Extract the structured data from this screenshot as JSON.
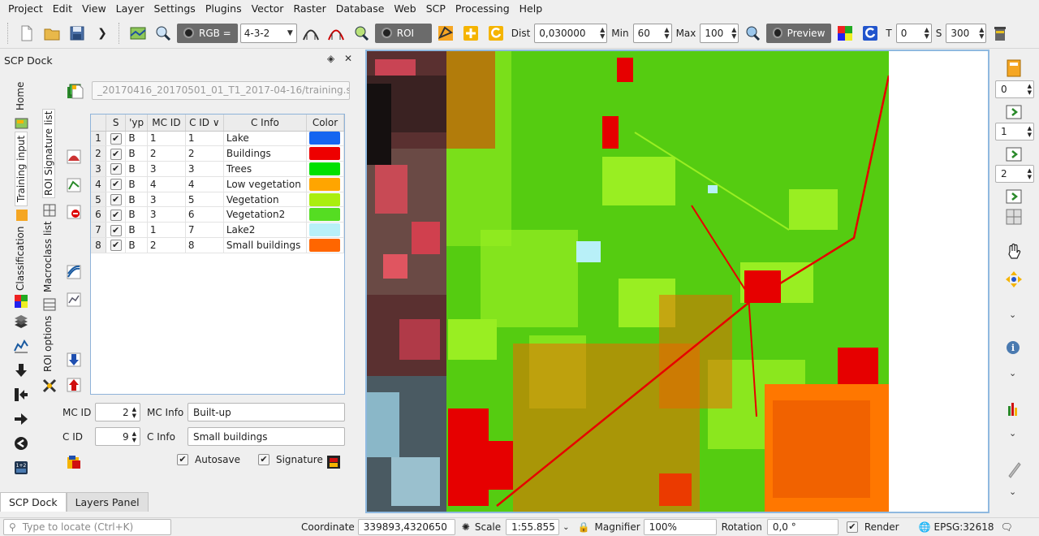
{
  "menubar": [
    "Project",
    "Edit",
    "View",
    "Layer",
    "Settings",
    "Plugins",
    "Vector",
    "Raster",
    "Database",
    "Web",
    "SCP",
    "Processing",
    "Help"
  ],
  "toolbar": {
    "rgb_label": "RGB =",
    "rgb_value": "4-3-2",
    "roi_label": "ROI",
    "dist_label": "Dist",
    "dist_value": "0,030000",
    "min_label": "Min",
    "min_value": "60",
    "max_label": "Max",
    "max_value": "100",
    "preview_label": "Preview",
    "t_label": "T",
    "t_value": "0",
    "s_label": "S",
    "s_value": "300"
  },
  "dock": {
    "title": "SCP Dock",
    "tabs_outer": [
      "Home",
      "Training input",
      "Classification"
    ],
    "tabs_inner": [
      "ROI Signature list",
      "Macroclass list",
      "ROI options"
    ],
    "training_file": "_20170416_20170501_01_T1_2017-04-16/training.scp",
    "table": {
      "headers": [
        "S",
        "Type",
        "MC ID",
        "C ID",
        "C Info",
        "Color"
      ],
      "header_display": [
        "S",
        "'yp",
        "MC ID",
        "C ID ∨",
        "C Info",
        "Color"
      ],
      "rows": [
        {
          "n": "1",
          "type": "B",
          "mc": "1",
          "c": "1",
          "info": "Lake",
          "color": "#1565f0"
        },
        {
          "n": "2",
          "type": "B",
          "mc": "2",
          "c": "2",
          "info": "Buildings",
          "color": "#ee0000"
        },
        {
          "n": "3",
          "type": "B",
          "mc": "3",
          "c": "3",
          "info": "Trees",
          "color": "#00e000"
        },
        {
          "n": "4",
          "type": "B",
          "mc": "4",
          "c": "4",
          "info": "Low vegetation",
          "color": "#ffa500"
        },
        {
          "n": "5",
          "type": "B",
          "mc": "3",
          "c": "5",
          "info": "Vegetation",
          "color": "#aaee10"
        },
        {
          "n": "6",
          "type": "B",
          "mc": "3",
          "c": "6",
          "info": "Vegetation2",
          "color": "#55dd22"
        },
        {
          "n": "7",
          "type": "B",
          "mc": "1",
          "c": "7",
          "info": "Lake2",
          "color": "#b8f0f8"
        },
        {
          "n": "8",
          "type": "B",
          "mc": "2",
          "c": "8",
          "info": "Small buildings",
          "color": "#ff6600"
        }
      ]
    },
    "form": {
      "mc_id_label": "MC ID",
      "mc_id_value": "2",
      "mc_info_label": "MC Info",
      "mc_info_value": "Built-up",
      "c_id_label": "C ID",
      "c_id_value": "9",
      "c_info_label": "C Info",
      "c_info_value": "Small buildings",
      "autosave_label": "Autosave",
      "signature_label": "Signature"
    },
    "bottom_tabs": [
      "SCP Dock",
      "Layers Panel"
    ]
  },
  "right_bar": {
    "spin1": "0",
    "spin2": "1",
    "spin3": "2"
  },
  "statusbar": {
    "locate_placeholder": "Type to locate (Ctrl+K)",
    "coordinate_label": "Coordinate",
    "coordinate_value": "339893,4320650",
    "scale_label": "Scale",
    "scale_value": "1:55.855",
    "magnifier_label": "Magnifier",
    "magnifier_value": "100%",
    "rotation_label": "Rotation",
    "rotation_value": "0,0 °",
    "render_label": "Render",
    "crs": "EPSG:32618"
  },
  "colors": {
    "class_green": "#55cc11",
    "class_lightgreen": "#99ee22",
    "class_red": "#e60000",
    "class_orange": "#ff7700",
    "water": "#b8f0f8"
  }
}
